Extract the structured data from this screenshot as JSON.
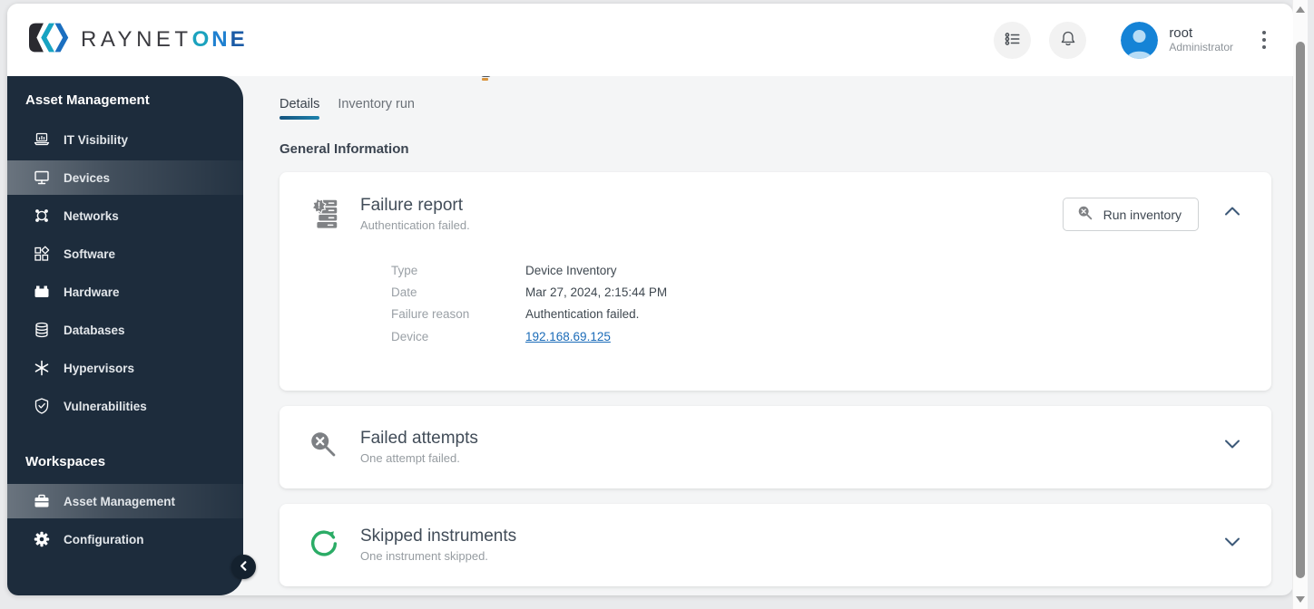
{
  "header": {
    "brand_primary": "RAYNET",
    "brand_o": "O",
    "brand_n": "N",
    "brand_e": "E",
    "user": {
      "name": "root",
      "role": "Administrator"
    }
  },
  "sidebar": {
    "sections": [
      {
        "title": "Asset Management",
        "items": [
          {
            "label": "IT Visibility",
            "icon": "laptop-chart-icon",
            "selected": false
          },
          {
            "label": "Devices",
            "icon": "monitor-icon",
            "selected": true
          },
          {
            "label": "Networks",
            "icon": "network-icon",
            "selected": false
          },
          {
            "label": "Software",
            "icon": "packages-icon",
            "selected": false
          },
          {
            "label": "Hardware",
            "icon": "hardware-icon",
            "selected": false
          },
          {
            "label": "Databases",
            "icon": "database-icon",
            "selected": false
          },
          {
            "label": "Hypervisors",
            "icon": "asterisk-icon",
            "selected": false
          },
          {
            "label": "Vulnerabilities",
            "icon": "shield-check-icon",
            "selected": false
          }
        ]
      },
      {
        "title": "Workspaces",
        "items": [
          {
            "label": "Asset Management",
            "icon": "briefcase-icon",
            "selected": true
          },
          {
            "label": "Configuration",
            "icon": "gear-icon",
            "selected": false
          }
        ]
      }
    ]
  },
  "main": {
    "tabs": [
      {
        "label": "Details",
        "active": true
      },
      {
        "label": "Inventory run",
        "active": false
      }
    ],
    "section_title": "General Information",
    "failure_report": {
      "title": "Failure report",
      "subtitle": "Authentication failed.",
      "run_inventory_label": "Run inventory",
      "fields": [
        {
          "label": "Type",
          "value": "Device Inventory"
        },
        {
          "label": "Date",
          "value": "Mar 27, 2024, 2:15:44 PM"
        },
        {
          "label": "Failure reason",
          "value": "Authentication failed."
        },
        {
          "label": "Device",
          "value": "192.168.69.125"
        }
      ]
    },
    "failed_attempts": {
      "title": "Failed attempts",
      "subtitle": "One attempt failed."
    },
    "skipped_instruments": {
      "title": "Skipped instruments",
      "subtitle": "One instrument skipped."
    }
  },
  "colors": {
    "sidebar_bg": "#1d2c3c",
    "accent_teal": "#1ba2be",
    "accent_blue": "#1f80d0",
    "tab_underline": "#14537e",
    "link_blue": "#1a6bb8",
    "success_green": "#2bac66",
    "icon_gray": "#7d7d7d"
  }
}
